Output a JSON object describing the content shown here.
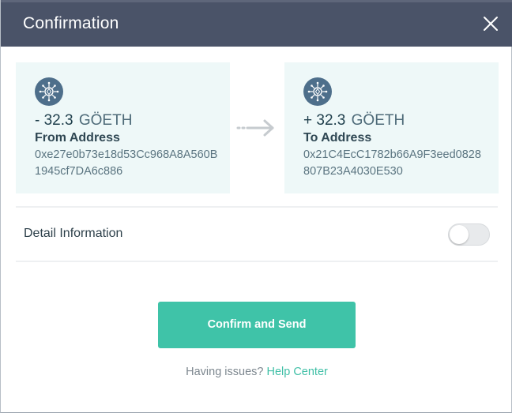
{
  "header": {
    "title": "Confirmation"
  },
  "from_card": {
    "icon": "ethereum-circle-icon",
    "amount": "- 32.3",
    "unit": "GÖETH",
    "label": "From Address",
    "address": "0xe27e0b73e18d53Cc968A8A560B1945cf7DA6c886"
  },
  "to_card": {
    "icon": "ethereum-circle-icon",
    "amount": "+ 32.3",
    "unit": "GÖETH",
    "label": "To Address",
    "address": "0x21C4EcC1782b66A9F3eed0828807B23A4030E530"
  },
  "details": {
    "label": "Detail Information",
    "toggle_on": false
  },
  "actions": {
    "confirm_label": "Confirm and Send",
    "help_prefix": "Having issues?",
    "help_link": "Help Center"
  },
  "colors": {
    "header_bg": "#4a5368",
    "card_bg": "#eef8f8",
    "accent": "#3fc3a8",
    "icon_bg": "#4e6f8b"
  }
}
